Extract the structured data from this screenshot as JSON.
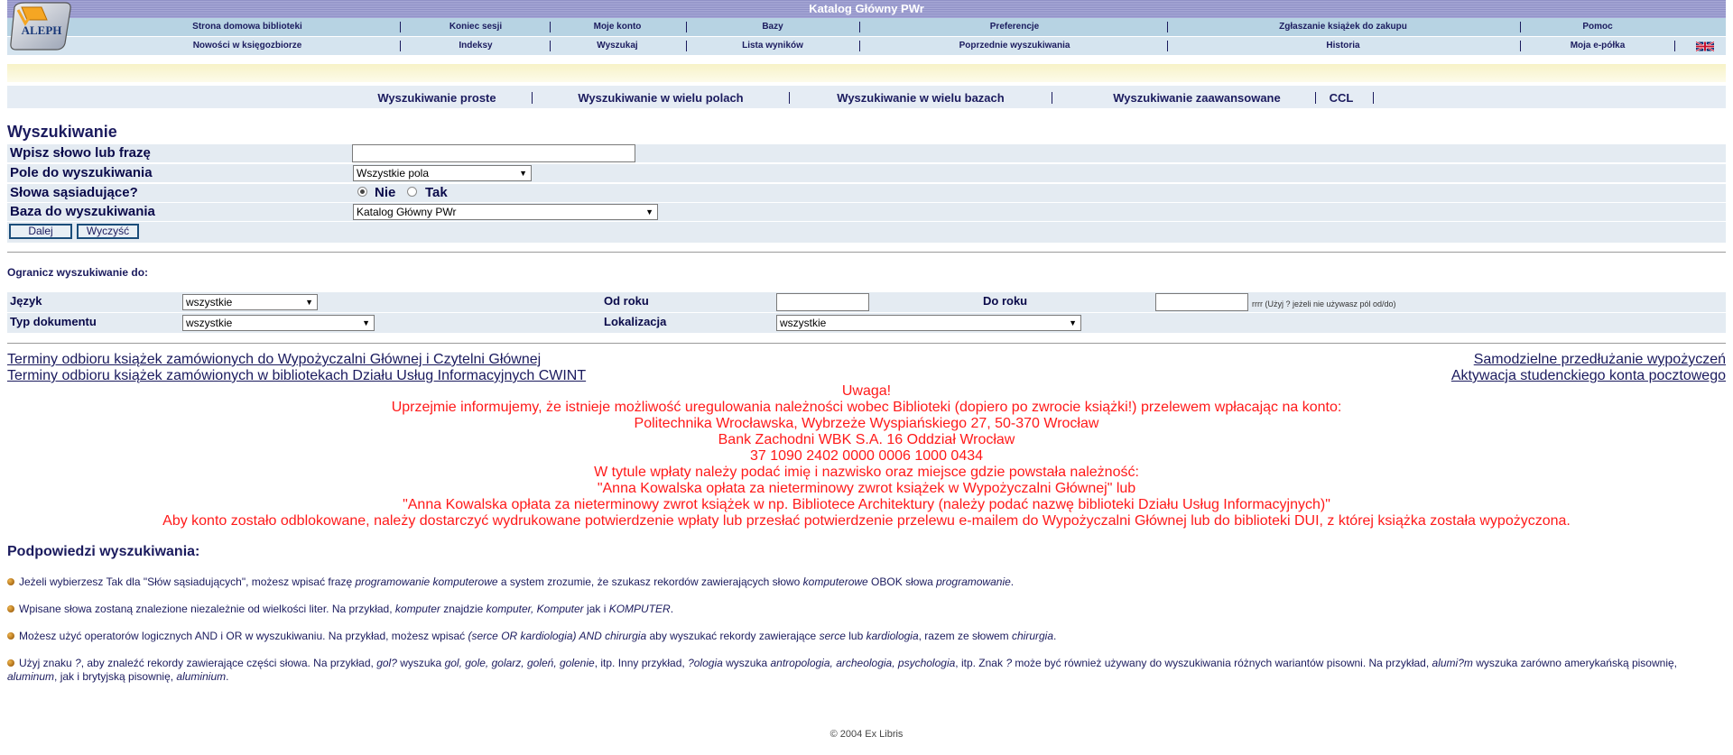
{
  "header": {
    "title": "Katalog Główny PWr",
    "logo_text": "ALEPH",
    "nav_row_1": [
      "Strona domowa biblioteki",
      "Koniec sesji",
      "Moje konto",
      "Bazy",
      "Preferencje",
      "Zgłaszanie książek do zakupu",
      "Pomoc"
    ],
    "nav_row_2": [
      "Nowości w księgozbiorze",
      "Indeksy",
      "Wyszukaj",
      "Lista wyników",
      "Poprzednie wyszukiwania",
      "Historia",
      "Moja e-półka"
    ],
    "flag_icon": "uk-flag-icon"
  },
  "search_tabs": [
    "Wyszukiwanie proste",
    "Wyszukiwanie w wielu polach",
    "Wyszukiwanie w wielu bazach",
    "Wyszukiwanie zaawansowane",
    "CCL"
  ],
  "form": {
    "title": "Wyszukiwanie",
    "query_label": "Wpisz słowo lub frazę",
    "query_value": "",
    "field_label": "Pole do wyszukiwania",
    "field_value": "Wszystkie pola",
    "adjacent_label": "Słowa sąsiadujące?",
    "adjacent_no": "Nie",
    "adjacent_yes": "Tak",
    "adjacent_selected": "Nie",
    "base_label": "Baza do wyszukiwania",
    "base_value": "Katalog Główny PWr",
    "submit_label": "Dalej",
    "clear_label": "Wyczyść"
  },
  "limits": {
    "title": "Ogranicz wyszukiwanie do:",
    "language_label": "Język",
    "language_value": "wszystkie",
    "year_from_label": "Od roku",
    "year_from_value": "",
    "year_to_label": "Do roku",
    "year_to_value": "",
    "year_hint": "rrrr (Użyj ? jeżeli nie używasz pól od/do)",
    "doctype_label": "Typ dokumentu",
    "doctype_value": "wszystkie",
    "location_label": "Lokalizacja",
    "location_value": "wszystkie"
  },
  "links": {
    "left_1": "Terminy odbioru książek zamówionych do Wypożyczalni Głównej i Czytelni Głównej",
    "left_2": "Terminy odbioru książek zamówionych w bibliotekach Działu Usług Informacyjnych CWINT",
    "right_1": "Samodzielne przedłużanie wypożyczeń",
    "right_2": "Aktywacja studenckiego konta pocztowego"
  },
  "notice": [
    "Uwaga!",
    "Uprzejmie informujemy, że istnieje możliwość uregulowania należności wobec Biblioteki (dopiero po zwrocie książki!) przelewem wpłacając na konto:",
    "Politechnika Wrocławska, Wybrzeże Wyspiańskiego 27, 50-370 Wrocław",
    "Bank Zachodni WBK S.A. 16 Oddział Wrocław",
    "37 1090 2402 0000 0006 1000 0434",
    "W tytule wpłaty należy podać imię i nazwisko oraz miejsce gdzie powstała należność:",
    "\"Anna Kowalska opłata za nieterminowy zwrot książek w Wypożyczalni Głównej\" lub",
    "\"Anna Kowalska opłata za nieterminowy zwrot książek w np. Bibliotece Architektury (należy podać nazwę biblioteki Działu Usług Informacyjnych)\"",
    "Aby konto zostało odblokowane, należy dostarczyć wydrukowane potwierdzenie wpłaty lub przesłać potwierdzenie przelewu e-mailem do Wypożyczalni Głównej lub do biblioteki DUI, z której książka została wypożyczona."
  ],
  "hints": {
    "title": "Podpowiedzi wyszukiwania:",
    "items": [
      [
        {
          "t": "Jeżeli wybierzesz Tak dla \"Słów sąsiadujących\", możesz wpisać frazę ",
          "i": false
        },
        {
          "t": "programowanie komputerowe",
          "i": true
        },
        {
          "t": " a system zrozumie, że szukasz rekordów zawierających słowo ",
          "i": false
        },
        {
          "t": "komputerowe",
          "i": true
        },
        {
          "t": " OBOK słowa ",
          "i": false
        },
        {
          "t": "programowanie",
          "i": true
        },
        {
          "t": ".",
          "i": false
        }
      ],
      [
        {
          "t": "Wpisane słowa zostaną znalezione niezależnie od wielkości liter. Na przykład, ",
          "i": false
        },
        {
          "t": "komputer",
          "i": true
        },
        {
          "t": " znajdzie ",
          "i": false
        },
        {
          "t": "komputer, Komputer",
          "i": true
        },
        {
          "t": " jak i ",
          "i": false
        },
        {
          "t": "KOMPUTER",
          "i": true
        },
        {
          "t": ".",
          "i": false
        }
      ],
      [
        {
          "t": "Możesz użyć operatorów logicznych AND i OR w wyszukiwaniu. Na przykład, możesz wpisać ",
          "i": false
        },
        {
          "t": "(serce OR kardiologia) AND chirurgia",
          "i": true
        },
        {
          "t": " aby wyszukać rekordy zawierające ",
          "i": false
        },
        {
          "t": "serce",
          "i": true
        },
        {
          "t": " lub ",
          "i": false
        },
        {
          "t": "kardiologia",
          "i": true
        },
        {
          "t": ", razem ze słowem ",
          "i": false
        },
        {
          "t": "chirurgia",
          "i": true
        },
        {
          "t": ".",
          "i": false
        }
      ],
      [
        {
          "t": "Użyj znaku ",
          "i": false
        },
        {
          "t": "?",
          "i": true
        },
        {
          "t": ", aby znaleźć rekordy zawierające części słowa. Na przykład, ",
          "i": false
        },
        {
          "t": "gol?",
          "i": true
        },
        {
          "t": " wyszuka ",
          "i": false
        },
        {
          "t": "gol, gole, golarz, goleń, golenie",
          "i": true
        },
        {
          "t": ", itp. Inny przykład, ",
          "i": false
        },
        {
          "t": "?ologia",
          "i": true
        },
        {
          "t": " wyszuka ",
          "i": false
        },
        {
          "t": "antropologia, archeologia, psychologia",
          "i": true
        },
        {
          "t": ", itp. Znak ",
          "i": false
        },
        {
          "t": "?",
          "i": true
        },
        {
          "t": " może być również używany do wyszukiwania różnych wariantów pisowni. Na przykład, ",
          "i": false
        },
        {
          "t": "alumi?m",
          "i": true
        },
        {
          "t": " wyszuka zarówno amerykańską pisownię, ",
          "i": false
        },
        {
          "t": "aluminum",
          "i": true
        },
        {
          "t": ", jak i brytyjską pisownię, ",
          "i": false
        },
        {
          "t": "aluminium",
          "i": true
        },
        {
          "t": ".",
          "i": false
        }
      ]
    ]
  },
  "footer": "© 2004 Ex Libris",
  "colors": {
    "notice": "#ff1a1a",
    "text": "#1b1b5e",
    "nav_row_1": "#b7d3e3",
    "nav_row_2": "#d5e4ef",
    "form_row": "#e4ebf2"
  }
}
